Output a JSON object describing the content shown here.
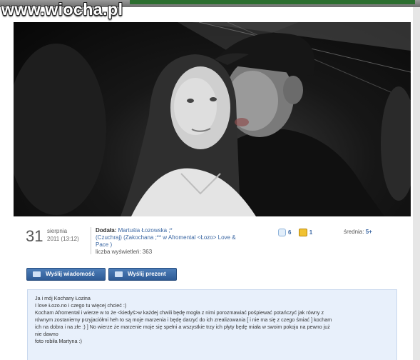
{
  "watermark": "www.wiocha.pl",
  "meta": {
    "day": "31",
    "month": "sierpnia",
    "year_time": "2011 (13:12)",
    "added_by_label": "Dodała:",
    "author": "Martuśia Łozowska ;*",
    "author_tags": "(Czuchraj) (Zakochana ;** w Afromental <Łozo> Love & Pace )",
    "views_label": "liczba wyświetleń: 363",
    "votes_up": "6",
    "votes_cup": "1",
    "avg_label": "średnia:",
    "avg_value": "5+"
  },
  "buttons": {
    "send_message": "Wyślij wiadomość",
    "send_gift": "Wyślij prezent"
  },
  "description": {
    "lines": [
      "Ja i mój Kochany Łozina",
      "I love Łozo.no i czego tu więcej chcieć :)",
      "Kocham Afromental i wierze w to że <kiedyś>w każdej chwili będę mogła z nimi porozmawiać pośpiewać potańczyć jak równy z",
      "równym zostaniemy przyjaciółmi heh to są moje marzenia i będę darzyć do ich zrealizowania [ i nie ma się z czego śmiać ] kocham",
      "ich na dobra i na złe :) ] No wierze że marzenie moje się spełni a wszystkie trzy ich płyty będę miała w swoim pokoju na pewno już",
      "nie dawno",
      "",
      "foto robiła Martyna :)"
    ]
  },
  "icons": {
    "vote_up": "shield-icon",
    "vote_cup": "trophy-icon",
    "msg": "envelope-icon",
    "gift": "gift-icon"
  },
  "colors": {
    "link": "#3b67a3",
    "button": "#2e5b95",
    "desc_bg": "#e8f0fb"
  }
}
